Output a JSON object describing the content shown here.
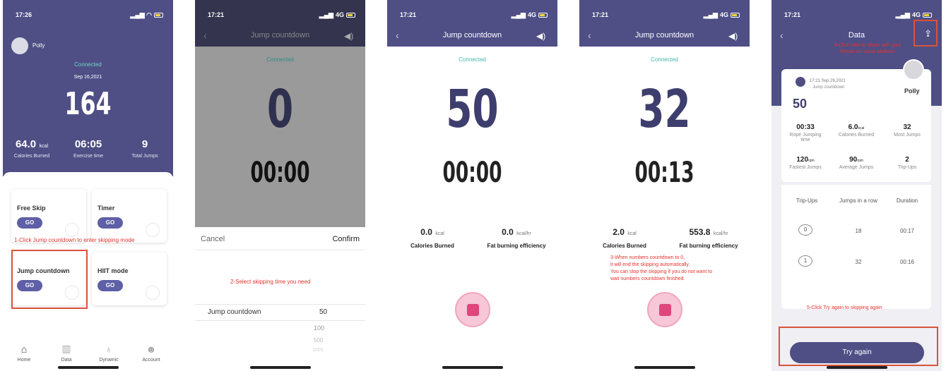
{
  "status_time_1": "17:26",
  "status_time": "17:21",
  "status_signal": "4G",
  "screen1": {
    "user": "Polly",
    "connected": "Connected",
    "date": "Sep 16,2021",
    "jumps": "164",
    "stats": [
      {
        "value": "64.0",
        "unit": "kcal",
        "label": "Calories Burned"
      },
      {
        "value": "06:05",
        "unit": "",
        "label": "Exercise time"
      },
      {
        "value": "9",
        "unit": "",
        "label": "Total Jumps"
      }
    ],
    "modes": [
      {
        "title": "Free Skip",
        "go": "GO"
      },
      {
        "title": "Timer",
        "go": "GO"
      },
      {
        "title": "Jump countdown",
        "go": "GO"
      },
      {
        "title": "HIIT mode",
        "go": "GO"
      }
    ],
    "instruction": "1-Click Jump countdown to enter skipping mode",
    "tabs": [
      "Home",
      "Data",
      "Dynamic",
      "Account"
    ]
  },
  "screen2": {
    "title": "Jump countdown",
    "connected": "Connected",
    "count": "0",
    "time": "00:00",
    "cancel": "Cancel",
    "confirm": "Confirm",
    "instruction": "2-Select skipping time you need",
    "picker_label": "Jump countdown",
    "picker_selected": "50",
    "picker_options": [
      "100",
      "500",
      "1000"
    ]
  },
  "screen3": {
    "title": "Jump countdown",
    "connected": "Connected",
    "count": "50",
    "time": "00:00",
    "calories_value": "0.0",
    "calories_unit": "kcal",
    "calories_label": "Calories Burned",
    "fat_value": "0.0",
    "fat_unit": "kcal/hr",
    "fat_label": "Fat burning efficiency"
  },
  "screen4": {
    "title": "Jump countdown",
    "connected": "Connected",
    "count": "32",
    "time": "00:13",
    "calories_value": "2.0",
    "calories_unit": "kcal",
    "calories_label": "Calories Burned",
    "fat_value": "553.8",
    "fat_unit": "kcal/hr",
    "fat_label": "Fat burning efficiency",
    "instruction_1": "3-When numbers countdown to 0,",
    "instruction_2": "it will end the skipping automatically.",
    "instruction_3": "You can stop the skipping if you do not want to",
    "instruction_4": "wait numbers countdown finished."
  },
  "screen5": {
    "title": "Data",
    "share_note_1": "4-Click here to share with your",
    "share_note_2": "friends on social platform",
    "record_time": "17:21 Sep.29,2021",
    "record_mode": "Jump countdown",
    "user": "Polly",
    "count": "50",
    "stats": [
      {
        "value": "00:33",
        "label": "Rope Jumping time"
      },
      {
        "value": "6.0",
        "unit": "kcal",
        "label": "Calories Burned"
      },
      {
        "value": "32",
        "label": "Most Jumps"
      },
      {
        "value": "120",
        "unit": "rpm",
        "label": "Fastest Jumps"
      },
      {
        "value": "90",
        "unit": "rpm",
        "label": "Average Jumps"
      },
      {
        "value": "2",
        "label": "Trip-Ups"
      }
    ],
    "table_headers": [
      "Trip-Ups",
      "Jumps in a row",
      "Duration"
    ],
    "table_rows": [
      {
        "trip": "0",
        "jumps": "18",
        "duration": "00:17"
      },
      {
        "trip": "1",
        "jumps": "32",
        "duration": "00:16"
      }
    ],
    "instruction": "5-Click Try again to skipping again",
    "try_again": "Try again"
  },
  "colors": {
    "accent": "#4f4f86",
    "stop": "#e0457b",
    "annotation": "#e5322d",
    "connected": "#40b6a8"
  }
}
